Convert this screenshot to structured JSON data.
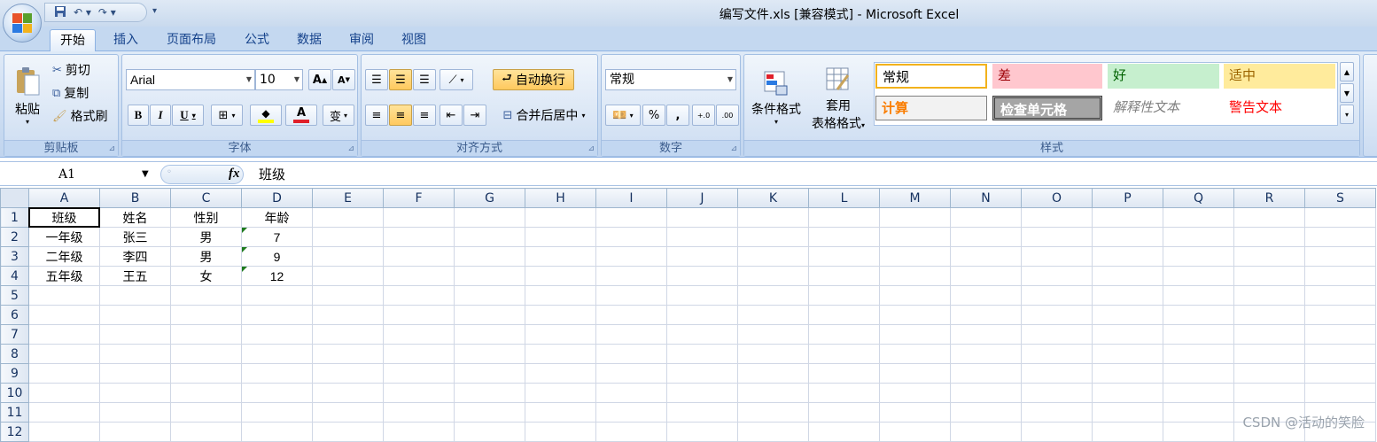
{
  "window": {
    "title": "编写文件.xls  [兼容模式] - Microsoft Excel"
  },
  "qat": {
    "save_icon": "save-icon",
    "undo_icon": "undo-icon",
    "redo_icon": "redo-icon",
    "more": "▾"
  },
  "tabs": [
    "开始",
    "插入",
    "页面布局",
    "公式",
    "数据",
    "审阅",
    "视图"
  ],
  "clipboard": {
    "paste": "粘贴",
    "cut": "剪切",
    "copy": "复制",
    "format_painter": "格式刷",
    "label": "剪贴板"
  },
  "font": {
    "name": "Arial",
    "size": "10",
    "grow": "A",
    "shrink": "A",
    "bold": "B",
    "italic": "I",
    "underline": "U",
    "phonetic": "变",
    "label": "字体",
    "font_color": "#e0202a",
    "fill_color": "#ffff00"
  },
  "alignment": {
    "wrap": "自动换行",
    "merge": "合并后居中",
    "label": "对齐方式"
  },
  "number": {
    "format": "常规",
    "percent": "%",
    "comma": ",",
    "inc": "←.0 .00",
    "dec": ".00 →.0",
    "label": "数字"
  },
  "styles": {
    "conditional": "条件格式",
    "table_fmt_1": "套用",
    "table_fmt_2": "表格格式",
    "label": "样式",
    "cells": [
      "常规",
      "差",
      "好",
      "适中",
      "计算",
      "检查单元格",
      "解释性文本",
      "警告文本"
    ]
  },
  "formula_bar": {
    "cell_ref": "A1",
    "fx": "fx",
    "content": "班级"
  },
  "sheet": {
    "columns": [
      "A",
      "B",
      "C",
      "D",
      "E",
      "F",
      "G",
      "H",
      "I",
      "J",
      "K",
      "L",
      "M",
      "N",
      "O",
      "P",
      "Q",
      "R",
      "S"
    ],
    "rows": [
      [
        "班级",
        "姓名",
        "性别",
        "年龄"
      ],
      [
        "一年级",
        "张三",
        "男",
        "7"
      ],
      [
        "二年级",
        "李四",
        "男",
        "9"
      ],
      [
        "五年级",
        "王五",
        "女",
        "12"
      ],
      [],
      [],
      [],
      [],
      [],
      [],
      [],
      []
    ],
    "row_numbers": [
      "1",
      "2",
      "3",
      "4",
      "5",
      "6",
      "7",
      "8",
      "9",
      "10",
      "11",
      "12"
    ]
  },
  "watermark": "CSDN @活动的笑脸"
}
